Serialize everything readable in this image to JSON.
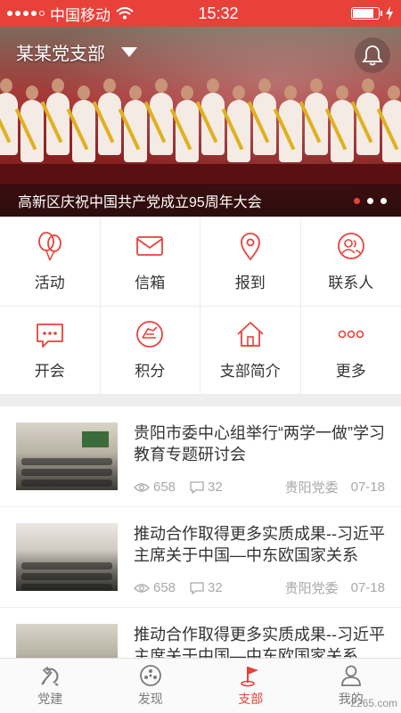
{
  "status": {
    "carrier": "中国移动",
    "time": "15:32",
    "battery_level": 0.85
  },
  "banner": {
    "branch_name": "某某党支部",
    "caption": "高新区庆祝中国共产党成立95周年大会",
    "slides": 3,
    "active_slide": 0
  },
  "grid": [
    {
      "label": "活动",
      "icon": "balloon-icon"
    },
    {
      "label": "信箱",
      "icon": "mail-icon"
    },
    {
      "label": "报到",
      "icon": "location-pin-icon"
    },
    {
      "label": "联系人",
      "icon": "contacts-icon"
    },
    {
      "label": "开会",
      "icon": "chat-bubble-icon"
    },
    {
      "label": "积分",
      "icon": "points-icon"
    },
    {
      "label": "支部简介",
      "icon": "home-icon"
    },
    {
      "label": "更多",
      "icon": "more-dots-icon"
    }
  ],
  "news": [
    {
      "title": "贵阳市委中心组举行“两学一做”学习教育专题研讨会",
      "views": "658",
      "comments": "32",
      "source": "贵阳党委",
      "date": "07-18"
    },
    {
      "title": "推动合作取得更多实质成果--习近平主席关于中国—中东欧国家关系",
      "views": "658",
      "comments": "32",
      "source": "贵阳党委",
      "date": "07-18"
    },
    {
      "title": "推动合作取得更多实质成果--习近平主席关于中国—中东欧国家关系",
      "views": "",
      "comments": "",
      "source": "",
      "date": ""
    }
  ],
  "tabs": [
    {
      "label": "党建",
      "icon": "party-emblem-icon",
      "active": false
    },
    {
      "label": "发现",
      "icon": "compass-icon",
      "active": false
    },
    {
      "label": "支部",
      "icon": "flag-icon",
      "active": true
    },
    {
      "label": "我的",
      "icon": "user-icon",
      "active": false
    }
  ],
  "watermark": "2265.com",
  "colors": {
    "brand_red": "#e8413a",
    "meta_gray": "#a9a9a9"
  }
}
